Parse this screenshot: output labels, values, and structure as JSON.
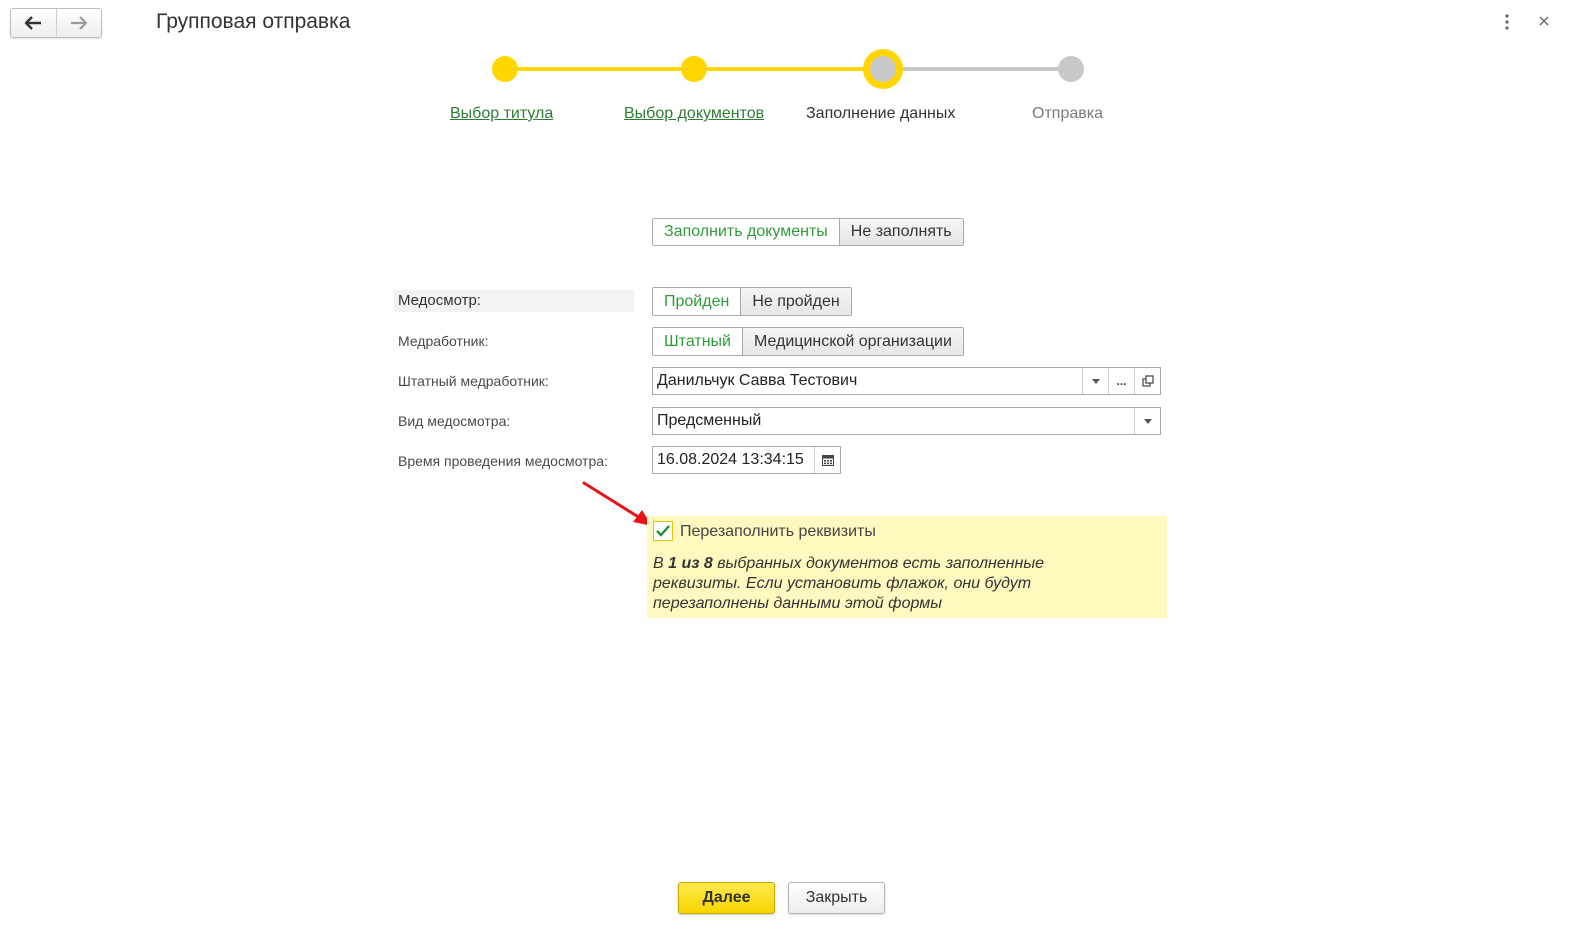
{
  "window": {
    "title": "Групповая отправка"
  },
  "stepper": {
    "steps": [
      {
        "label": "Выбор титула",
        "state": "done"
      },
      {
        "label": "Выбор документов",
        "state": "done"
      },
      {
        "label": "Заполнение данных",
        "state": "current"
      },
      {
        "label": "Отправка",
        "state": "pending"
      }
    ],
    "colors": {
      "done": "#ffd600",
      "pending": "#c8c8c8",
      "link": "#2e7d32"
    }
  },
  "fill_toggle": {
    "options": [
      "Заполнить документы",
      "Не заполнять"
    ],
    "selected": "Заполнить документы"
  },
  "form": {
    "medosmotr": {
      "label": "Медосмотр:",
      "options": [
        "Пройден",
        "Не пройден"
      ],
      "selected": "Пройден"
    },
    "medworker": {
      "label": "Медработник:",
      "options": [
        "Штатный",
        "Медицинской организации"
      ],
      "selected": "Штатный"
    },
    "staff_medworker": {
      "label": "Штатный медработник:",
      "value": "Данильчук Савва Тестович",
      "more_button": "..."
    },
    "exam_type": {
      "label": "Вид медосмотра:",
      "value": "Предсменный"
    },
    "exam_time": {
      "label": "Время проведения медосмотра:",
      "value": "16.08.2024 13:34:15"
    }
  },
  "refill": {
    "checkbox_label": "Перезаполнить реквизиты",
    "checked": true,
    "note_prefix": "В ",
    "note_count": "1 из 8",
    "note_line1_rest": " выбранных документов есть заполненные",
    "note_line2": "реквизиты. Если установить флажок, они будут",
    "note_line3": "перезаполнены данными этой формы"
  },
  "footer": {
    "next_label": "Далее",
    "close_label": "Закрыть"
  },
  "accent_colors": {
    "primary_button": "#f7d500",
    "selected_toggle_text": "#2e9b3a",
    "notice_background": "#fff9c0"
  }
}
